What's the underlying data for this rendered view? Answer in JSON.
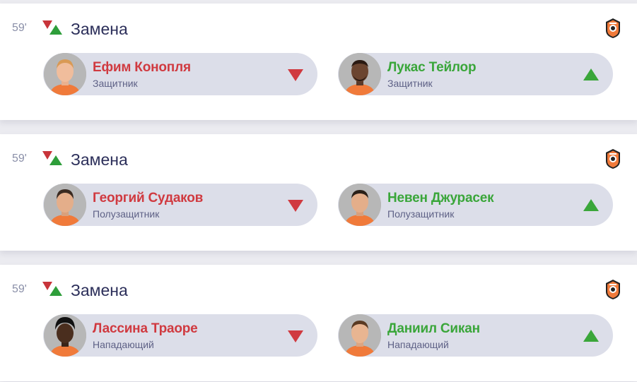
{
  "colors": {
    "player_out": "#d03a40",
    "player_in": "#3aa63a",
    "title": "#2c2f5a",
    "pill_background": "#dcdee9",
    "jersey": "#f07a3a"
  },
  "icons": {
    "substitution": "substitution-icon",
    "arrow_down": "arrow-down-icon",
    "arrow_up": "arrow-up-icon",
    "club": "shakhtar-logo-icon"
  },
  "events": [
    {
      "minute": "59'",
      "title": "Замена",
      "out": {
        "name": "Ефим Конопля",
        "position": "Защитник"
      },
      "in": {
        "name": "Лукас Тейлор",
        "position": "Защитник"
      }
    },
    {
      "minute": "59'",
      "title": "Замена",
      "out": {
        "name": "Георгий Судаков",
        "position": "Полузащитник"
      },
      "in": {
        "name": "Невен Джурасек",
        "position": "Полузащитник"
      }
    },
    {
      "minute": "59'",
      "title": "Замена",
      "out": {
        "name": "Лассина Траоре",
        "position": "Нападающий"
      },
      "in": {
        "name": "Даниил Сикан",
        "position": "Нападающий"
      }
    }
  ]
}
